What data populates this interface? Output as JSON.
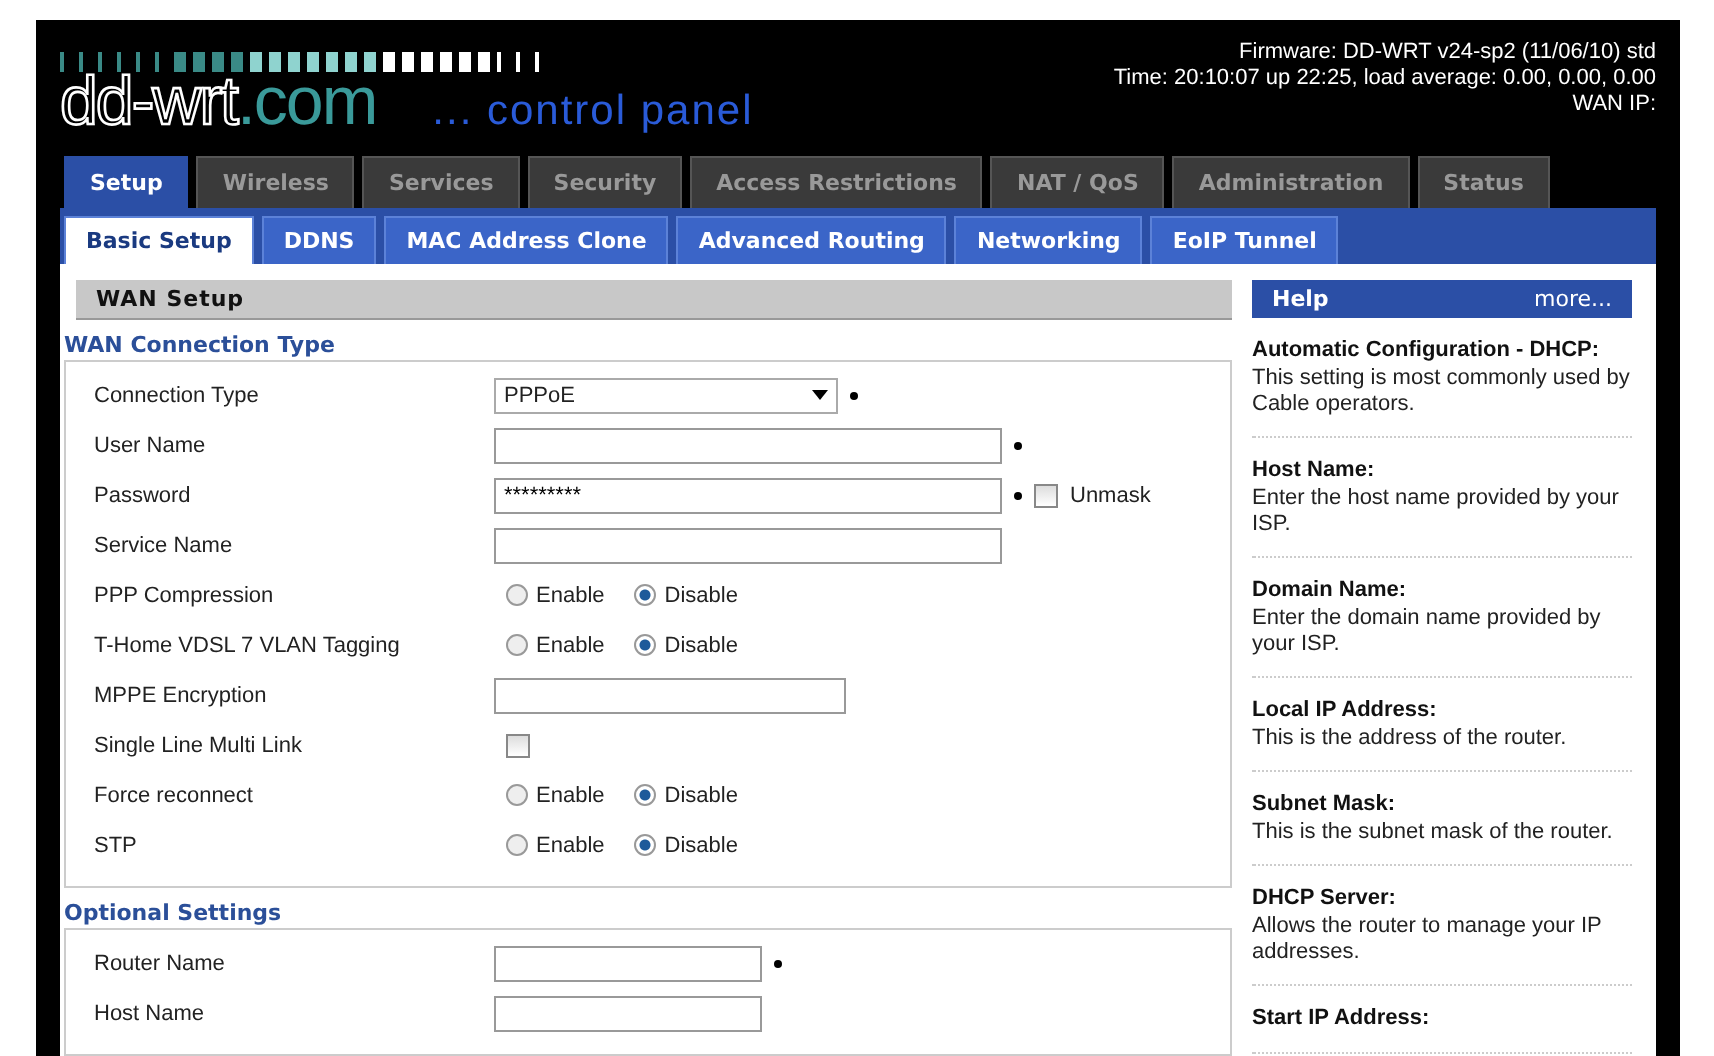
{
  "header": {
    "logo_main": "dd-wrt",
    "logo_suffix": ".com",
    "subtitle": "... control panel",
    "info": [
      "Firmware: DD-WRT v24-sp2 (11/06/10) std",
      "Time: 20:10:07 up 22:25, load average: 0.00, 0.00, 0.00",
      "WAN IP:"
    ]
  },
  "tabs": [
    {
      "label": "Setup",
      "selected": true
    },
    {
      "label": "Wireless",
      "selected": false
    },
    {
      "label": "Services",
      "selected": false
    },
    {
      "label": "Security",
      "selected": false
    },
    {
      "label": "Access Restrictions",
      "selected": false
    },
    {
      "label": "NAT / QoS",
      "selected": false
    },
    {
      "label": "Administration",
      "selected": false
    },
    {
      "label": "Status",
      "selected": false
    }
  ],
  "subtabs": [
    {
      "label": "Basic Setup",
      "selected": true
    },
    {
      "label": "DDNS",
      "selected": false
    },
    {
      "label": "MAC Address Clone",
      "selected": false
    },
    {
      "label": "Advanced Routing",
      "selected": false
    },
    {
      "label": "Networking",
      "selected": false
    },
    {
      "label": "EoIP Tunnel",
      "selected": false
    }
  ],
  "section_title": "WAN Setup",
  "fieldsets": [
    {
      "legend": "WAN Connection Type",
      "rows": [
        {
          "kind": "select",
          "label": "Connection Type",
          "value": "PPPoE",
          "required": true
        },
        {
          "kind": "text",
          "label": "User Name",
          "required": true
        },
        {
          "kind": "text",
          "label": "Password",
          "value": "*********",
          "required": true,
          "extra": {
            "label": "Unmask",
            "checked": false
          }
        },
        {
          "kind": "text",
          "label": "Service Name"
        },
        {
          "kind": "radio",
          "label": "PPP Compression",
          "options": [
            {
              "label": "Enable",
              "selected": false
            },
            {
              "label": "Disable",
              "selected": true
            }
          ]
        },
        {
          "kind": "radio",
          "label": "T-Home VDSL 7 VLAN Tagging",
          "options": [
            {
              "label": "Enable",
              "selected": false
            },
            {
              "label": "Disable",
              "selected": true
            }
          ]
        },
        {
          "kind": "text",
          "label": "MPPE Encryption"
        },
        {
          "kind": "checkbox",
          "label": "Single Line Multi Link",
          "checked": false
        },
        {
          "kind": "radio",
          "label": "Force reconnect",
          "options": [
            {
              "label": "Enable",
              "selected": false
            },
            {
              "label": "Disable",
              "selected": true
            }
          ]
        },
        {
          "kind": "radio",
          "label": "STP",
          "options": [
            {
              "label": "Enable",
              "selected": false
            },
            {
              "label": "Disable",
              "selected": true
            }
          ]
        }
      ]
    },
    {
      "legend": "Optional Settings",
      "rows": [
        {
          "kind": "text",
          "label": "Router Name",
          "required": true
        },
        {
          "kind": "text",
          "label": "Host Name"
        }
      ]
    }
  ],
  "help": {
    "title": "Help",
    "more": "more...",
    "items": [
      {
        "title": "Automatic Configuration - DHCP:",
        "text": "This setting is most commonly used by Cable operators."
      },
      {
        "title": "Host Name:",
        "text": "Enter the host name provided by your ISP."
      },
      {
        "title": "Domain Name:",
        "text": "Enter the domain name provided by your ISP."
      },
      {
        "title": "Local IP Address:",
        "text": "This is the address of the router."
      },
      {
        "title": "Subnet Mask:",
        "text": "This is the subnet mask of the router."
      },
      {
        "title": "DHCP Server:",
        "text": "Allows the router to manage your IP addresses."
      },
      {
        "title": "Start IP Address:"
      }
    ]
  }
}
